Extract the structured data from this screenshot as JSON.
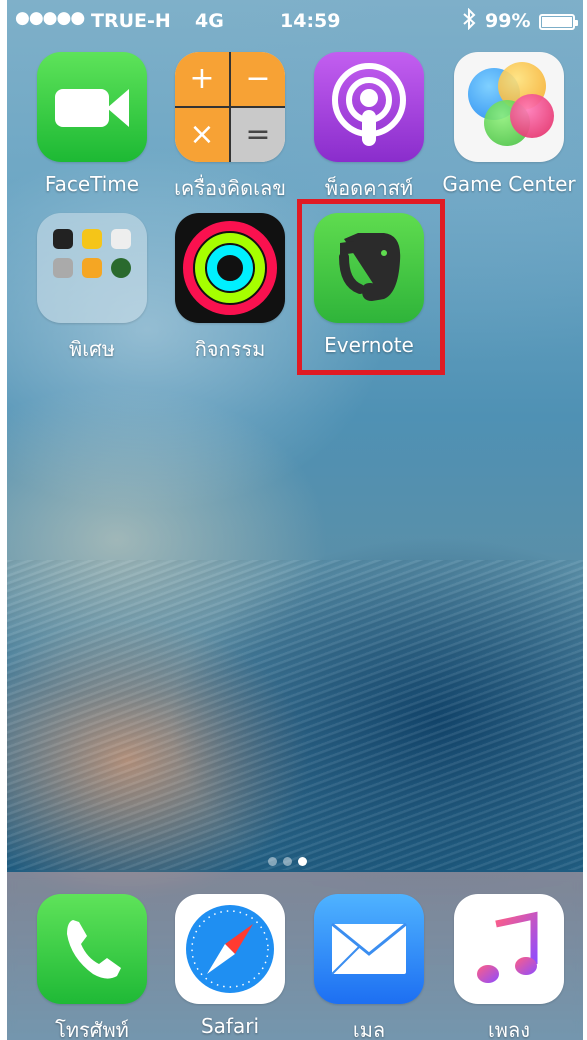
{
  "status_bar": {
    "signal": "●●●●●",
    "carrier": "TRUE-H",
    "network": "4G",
    "time": "14:59",
    "bluetooth_icon": "bluetooth-icon",
    "battery_percent": "99%",
    "battery_level": 0.99
  },
  "home": {
    "apps": [
      {
        "label": "FaceTime",
        "icon": "facetime-icon"
      },
      {
        "label": "เครื่องคิดเลข",
        "icon": "calculator-icon",
        "keys": [
          "+",
          "−",
          "×",
          "="
        ]
      },
      {
        "label": "พ็อดคาสท์",
        "icon": "podcasts-icon"
      },
      {
        "label": "Game Center",
        "icon": "game-center-icon"
      },
      {
        "label": "พิเศษ",
        "icon": "folder-icon"
      },
      {
        "label": "กิจกรรม",
        "icon": "activity-icon"
      },
      {
        "label": "Evernote",
        "icon": "evernote-icon"
      }
    ],
    "highlight_color": "#e01b24",
    "page_count": 3,
    "current_page": 3
  },
  "dock": {
    "apps": [
      {
        "label": "โทรศัพท์",
        "icon": "phone-icon"
      },
      {
        "label": "Safari",
        "icon": "safari-icon"
      },
      {
        "label": "เมล",
        "icon": "mail-icon"
      },
      {
        "label": "เพลง",
        "icon": "music-icon"
      }
    ]
  }
}
